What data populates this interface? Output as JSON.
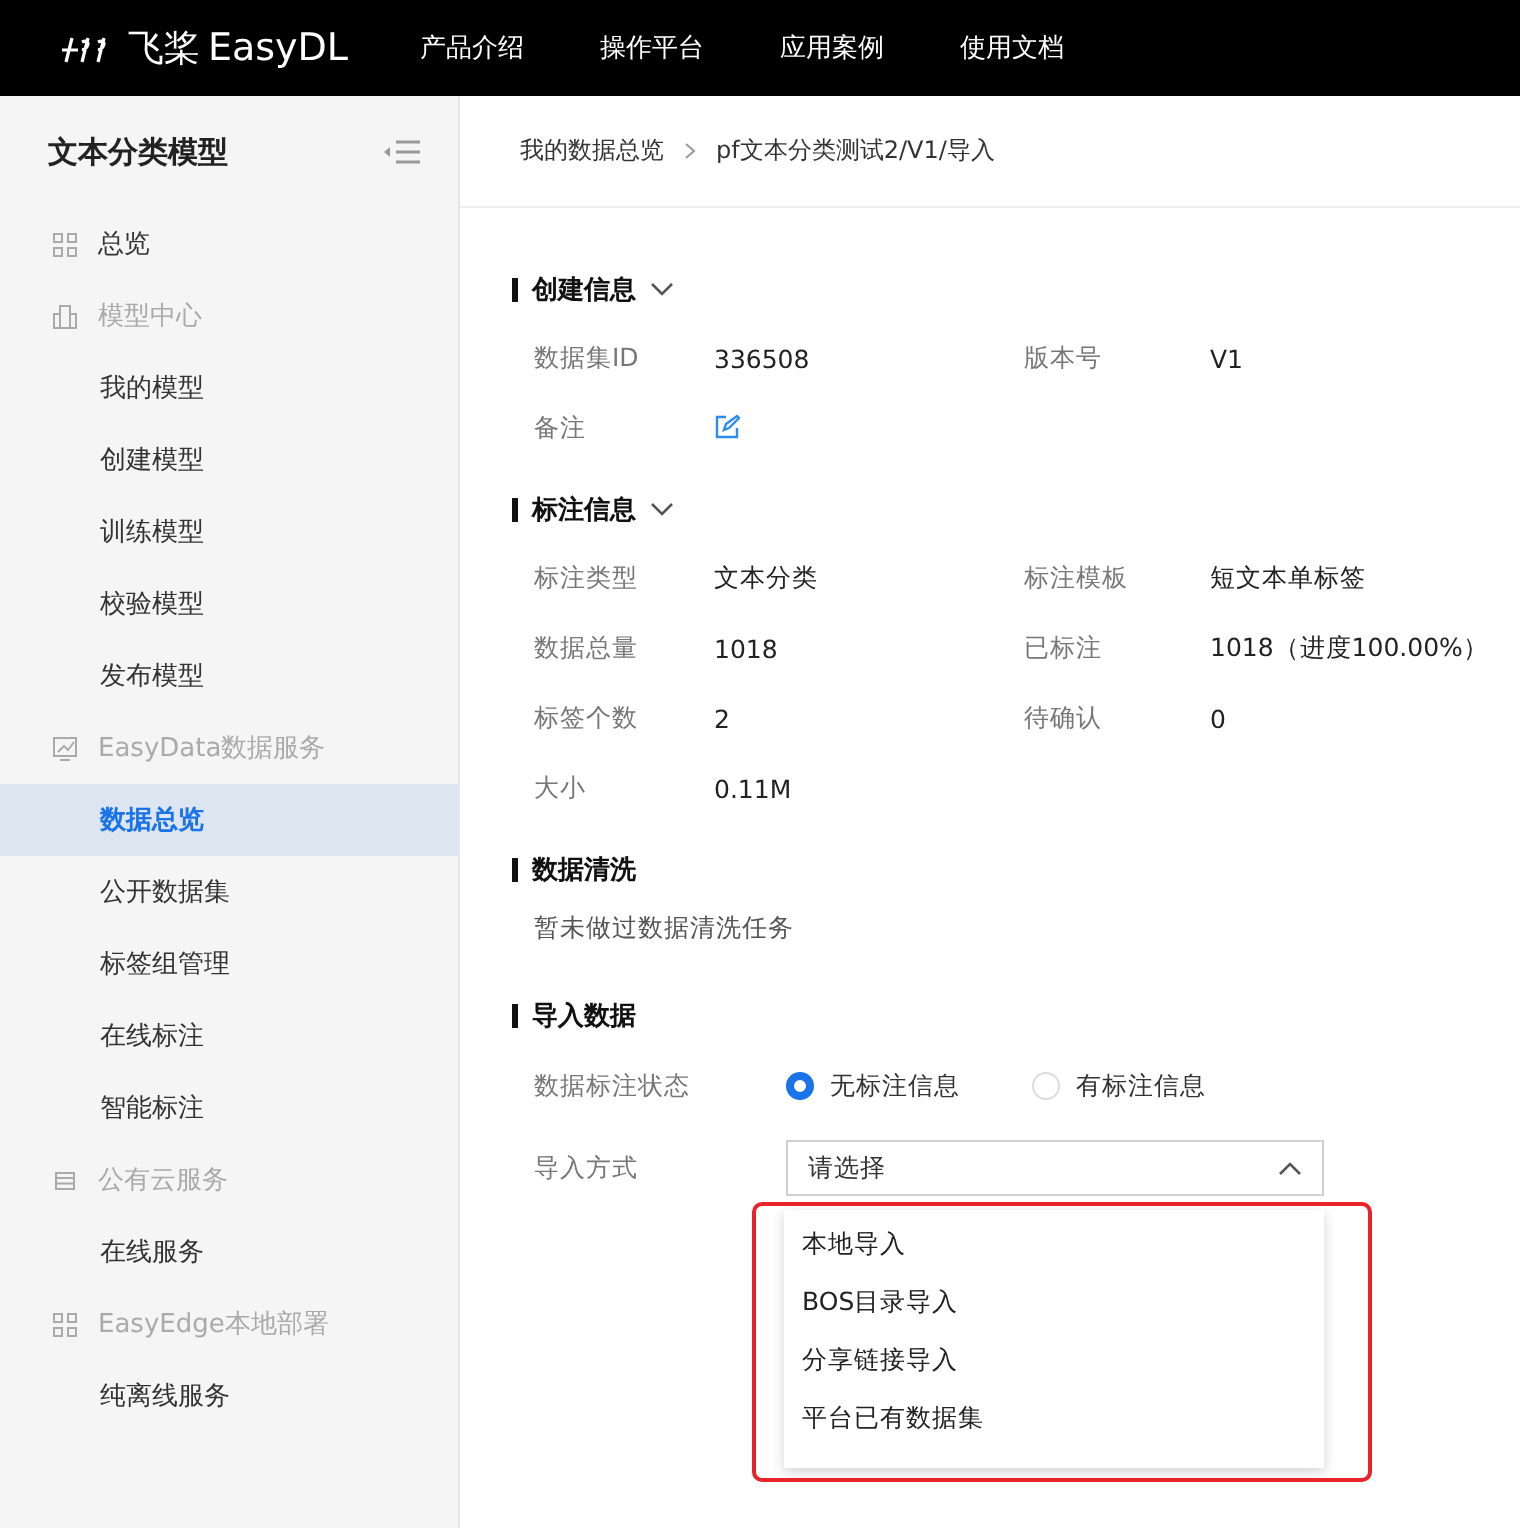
{
  "header": {
    "logo": "飞桨",
    "brand": "EasyDL",
    "nav": [
      "产品介绍",
      "操作平台",
      "应用案例",
      "使用文档"
    ]
  },
  "sidebar": {
    "title": "文本分类模型",
    "items": [
      {
        "kind": "top",
        "label": "总览",
        "selected": false
      },
      {
        "kind": "group",
        "label": "模型中心",
        "selected": false
      },
      {
        "kind": "item",
        "label": "我的模型",
        "selected": false
      },
      {
        "kind": "item",
        "label": "创建模型",
        "selected": false
      },
      {
        "kind": "item",
        "label": "训练模型",
        "selected": false
      },
      {
        "kind": "item",
        "label": "校验模型",
        "selected": false
      },
      {
        "kind": "item",
        "label": "发布模型",
        "selected": false
      },
      {
        "kind": "group",
        "label": "EasyData数据服务",
        "selected": false
      },
      {
        "kind": "item",
        "label": "数据总览",
        "selected": true
      },
      {
        "kind": "item",
        "label": "公开数据集",
        "selected": false
      },
      {
        "kind": "item",
        "label": "标签组管理",
        "selected": false
      },
      {
        "kind": "item",
        "label": "在线标注",
        "selected": false
      },
      {
        "kind": "item",
        "label": "智能标注",
        "selected": false
      },
      {
        "kind": "group",
        "label": "公有云服务",
        "selected": false
      },
      {
        "kind": "item",
        "label": "在线服务",
        "selected": false
      },
      {
        "kind": "group",
        "label": "EasyEdge本地部署",
        "selected": false
      },
      {
        "kind": "item",
        "label": "纯离线服务",
        "selected": false
      }
    ]
  },
  "breadcrumb": [
    "我的数据总览",
    "pf文本分类测试2/V1/导入"
  ],
  "sections": [
    {
      "kind": "fields",
      "title": "创建信息",
      "collapsible": true,
      "rows": [
        [
          {
            "label": "数据集ID",
            "value": "336508"
          },
          {
            "label": "版本号",
            "value": "V1"
          }
        ],
        [
          {
            "label": "备注",
            "kind": "edit"
          }
        ]
      ]
    },
    {
      "kind": "fields",
      "title": "标注信息",
      "collapsible": true,
      "rows": [
        [
          {
            "label": "标注类型",
            "value": "文本分类"
          },
          {
            "label": "标注模板",
            "value": "短文本单标签"
          }
        ],
        [
          {
            "label": "数据总量",
            "value": "1018"
          },
          {
            "label": "已标注",
            "value": "1018（进度100.00%）"
          }
        ],
        [
          {
            "label": "标签个数",
            "value": "2"
          },
          {
            "label": "待确认",
            "value": "0"
          }
        ],
        [
          {
            "label": "大小",
            "value": "0.11M"
          }
        ]
      ]
    },
    {
      "kind": "text",
      "title": "数据清洗",
      "collapsible": false,
      "text": "暂未做过数据清洗任务"
    },
    {
      "kind": "form",
      "title": "导入数据",
      "collapsible": false,
      "radio": {
        "label": "数据标注状态",
        "options": [
          {
            "label": "无标注信息",
            "selected": true
          },
          {
            "label": "有标注信息",
            "selected": false
          }
        ]
      },
      "select": {
        "label": "导入方式",
        "placeholder": "请选择",
        "expanded": true,
        "highlighted": true,
        "options": [
          "本地导入",
          "BOS目录导入",
          "分享链接导入",
          "平台已有数据集"
        ]
      }
    }
  ]
}
